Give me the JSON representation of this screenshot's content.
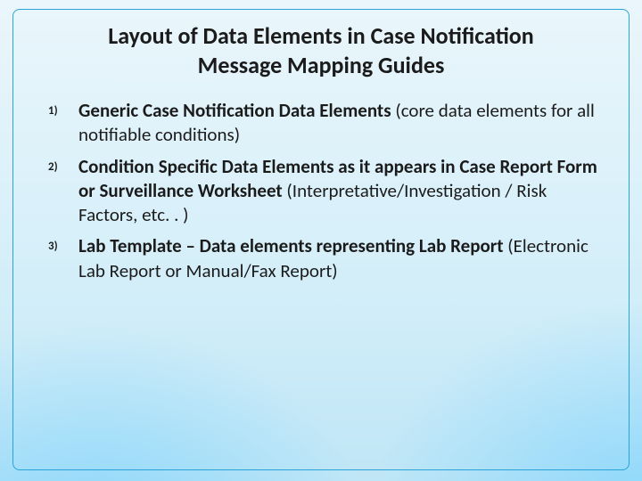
{
  "title": "Layout of Data Elements in Case Notification Message Mapping Guides",
  "items": [
    {
      "num": "1)",
      "strong": "Generic Case Notification Data Elements",
      "rest": "   (core data elements for all notifiable conditions)"
    },
    {
      "num": "2)",
      "strong": "Condition Specific Data Elements as it appears in Case Report Form or Surveillance Worksheet",
      "rest": " (Interpretative/Investigation / Risk Factors, etc. . )"
    },
    {
      "num": "3)",
      "strong": "Lab Template – Data elements representing Lab Report",
      "rest": " (Electronic Lab Report or Manual/Fax Report)"
    }
  ]
}
